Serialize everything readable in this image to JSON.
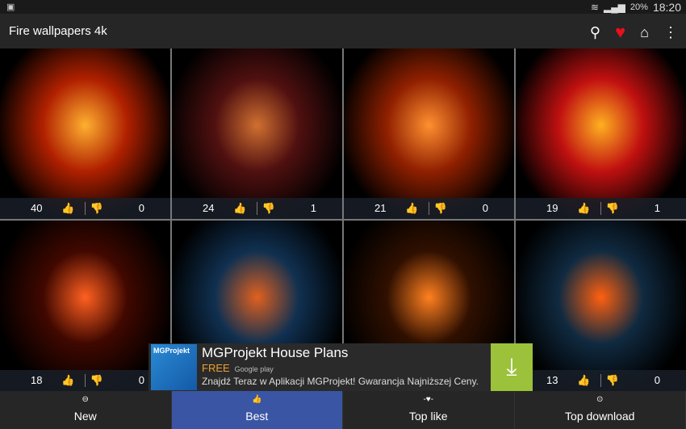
{
  "status": {
    "notification_icon": "screenshot-icon",
    "wifi_icon": "wifi-icon",
    "signal_icon": "signal-icon",
    "battery": "20%",
    "time": "18:20"
  },
  "appbar": {
    "title": "Fire wallpapers 4k",
    "actions": [
      "search-icon",
      "heart-icon",
      "home-icon",
      "more-icon"
    ]
  },
  "tiles": [
    {
      "likes": "40",
      "dislikes": "0",
      "colors": [
        "#ffb030",
        "#b02000"
      ]
    },
    {
      "likes": "24",
      "dislikes": "1",
      "colors": [
        "#d07030",
        "#501010"
      ]
    },
    {
      "likes": "21",
      "dislikes": "0",
      "colors": [
        "#ff9030",
        "#902000"
      ]
    },
    {
      "likes": "19",
      "dislikes": "1",
      "colors": [
        "#ffb020",
        "#c01010"
      ]
    },
    {
      "likes": "18",
      "dislikes": "0",
      "colors": [
        "#ff6020",
        "#400800"
      ]
    },
    {
      "colors": [
        "#e06020",
        "#103050"
      ]
    },
    {
      "colors": [
        "#ff8020",
        "#301000"
      ]
    },
    {
      "likes": "13",
      "dislikes": "0",
      "colors": [
        "#ff6010",
        "#102a40"
      ]
    }
  ],
  "ad": {
    "logo": "MGProjekt",
    "title": "MGProjekt House Plans",
    "price": "FREE",
    "store": "Google play",
    "description": "Znajdź Teraz w Aplikacji MGProjekt! Gwarancja Najniższej Ceny.",
    "accent": "#9bc23a"
  },
  "nav": {
    "items": [
      {
        "label": "New",
        "icon": "new-icon"
      },
      {
        "label": "Best",
        "icon": "thumbs-up-icon",
        "active": true
      },
      {
        "label": "Top like",
        "icon": "heart-beat-icon"
      },
      {
        "label": "Top download",
        "icon": "download-icon"
      }
    ],
    "active_color": "#3a55a3"
  }
}
